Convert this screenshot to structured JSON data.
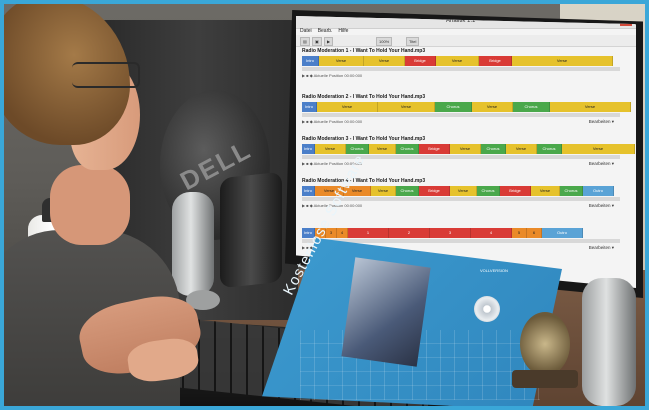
{
  "app": {
    "window_title": "Analitik 1.1",
    "menu": [
      "Datei",
      "Bearb.",
      "Hilfe"
    ],
    "toolbar": [
      "100%",
      "Titel"
    ]
  },
  "songs": [
    {
      "title": "Radio Moderation 1 - I Want To Hold Your Hand.mp3",
      "segments": [
        {
          "label": "Intro",
          "color": "blue",
          "w": 16
        },
        {
          "label": "Verse",
          "color": "yellow",
          "w": 44
        },
        {
          "label": "Verse",
          "color": "yellow",
          "w": 40
        },
        {
          "label": "Bridge",
          "color": "red",
          "w": 30
        },
        {
          "label": "Verse",
          "color": "yellow",
          "w": 42
        },
        {
          "label": "Bridge",
          "color": "red",
          "w": 32
        },
        {
          "label": "Verse",
          "color": "yellow",
          "w": 100
        }
      ],
      "status": "Aktuelle Position 00:00:000"
    },
    {
      "title": "Radio Moderation 2 - I Want To Hold Your Hand.mp3",
      "segments": [
        {
          "label": "Intro",
          "color": "blue",
          "w": 14
        },
        {
          "label": "Verse",
          "color": "yellow",
          "w": 60
        },
        {
          "label": "Verse",
          "color": "yellow",
          "w": 56
        },
        {
          "label": "Chorus",
          "color": "green",
          "w": 36
        },
        {
          "label": "Verse",
          "color": "yellow",
          "w": 40
        },
        {
          "label": "Chorus",
          "color": "green",
          "w": 36
        },
        {
          "label": "Verse",
          "color": "yellow",
          "w": 80
        }
      ],
      "status": "Aktuelle Position 00:00:000",
      "edit": "Bearbeiten"
    },
    {
      "title": "Radio Moderation 3 - I Want To Hold Your Hand.mp3",
      "segments": [
        {
          "label": "Intro",
          "color": "blue",
          "w": 12
        },
        {
          "label": "Verse",
          "color": "yellow",
          "w": 30
        },
        {
          "label": "Chorus",
          "color": "green",
          "w": 22
        },
        {
          "label": "Verse",
          "color": "yellow",
          "w": 26
        },
        {
          "label": "Chorus",
          "color": "green",
          "w": 22
        },
        {
          "label": "Bridge",
          "color": "red",
          "w": 30
        },
        {
          "label": "Verse",
          "color": "yellow",
          "w": 30
        },
        {
          "label": "Chorus",
          "color": "green",
          "w": 24
        },
        {
          "label": "Verse",
          "color": "yellow",
          "w": 30
        },
        {
          "label": "Chorus",
          "color": "green",
          "w": 24
        },
        {
          "label": "Verse",
          "color": "yellow",
          "w": 72
        }
      ],
      "status": "Aktuelle Position 00:00:000",
      "edit": "Bearbeiten"
    },
    {
      "title": "Radio Moderation 4 - I Want To Hold Your Hand.mp3",
      "segments": [
        {
          "label": "Intro",
          "color": "blue",
          "w": 12
        },
        {
          "label": "Verse",
          "color": "orange",
          "w": 28
        },
        {
          "label": "Verse",
          "color": "orange",
          "w": 26
        },
        {
          "label": "Verse",
          "color": "yellow",
          "w": 24
        },
        {
          "label": "Chorus",
          "color": "green",
          "w": 22
        },
        {
          "label": "Bridge",
          "color": "red",
          "w": 30
        },
        {
          "label": "Verse",
          "color": "yellow",
          "w": 26
        },
        {
          "label": "Chorus",
          "color": "green",
          "w": 22
        },
        {
          "label": "Bridge",
          "color": "red",
          "w": 30
        },
        {
          "label": "Verse",
          "color": "yellow",
          "w": 28
        },
        {
          "label": "Chorus",
          "color": "green",
          "w": 22
        },
        {
          "label": "Outro",
          "color": "lblue",
          "w": 30
        }
      ],
      "status": "Aktuelle Position 00:00:000",
      "edit": "Bearbeiten"
    },
    {
      "title": "",
      "segments": [
        {
          "label": "Intro",
          "color": "blue",
          "w": 12
        },
        {
          "label": "2",
          "color": "orange",
          "w": 10
        },
        {
          "label": "3",
          "color": "orange",
          "w": 10
        },
        {
          "label": "4",
          "color": "orange",
          "w": 10
        },
        {
          "label": "1",
          "color": "red",
          "w": 40
        },
        {
          "label": "2",
          "color": "red",
          "w": 40
        },
        {
          "label": "3",
          "color": "red",
          "w": 40
        },
        {
          "label": "4",
          "color": "red",
          "w": 40
        },
        {
          "label": "5",
          "color": "orange",
          "w": 14
        },
        {
          "label": "6",
          "color": "orange",
          "w": 14
        },
        {
          "label": "Outro",
          "color": "lblue",
          "w": 40
        }
      ],
      "status": "Aktuelle Position 00:00:000",
      "edit": "Bearbeiten"
    }
  ],
  "box": {
    "title": "Kostenlose Software",
    "brand": "VOLLVERSION"
  }
}
